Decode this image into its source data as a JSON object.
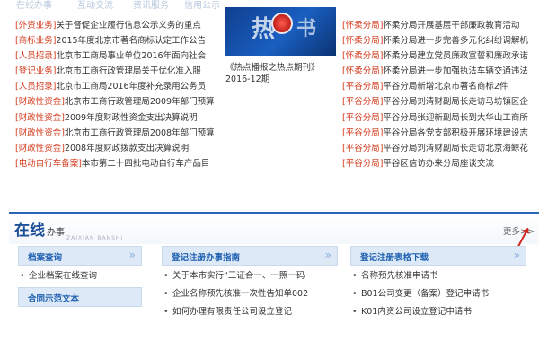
{
  "topnav": [
    "在线办事",
    "互动交流",
    "资讯服务",
    "信用公示"
  ],
  "left_news": [
    {
      "tag": "[外资业务]",
      "text": "关于督促企业履行信息公示义务的重点"
    },
    {
      "tag": "[商标业务]",
      "text": "2015年度北京市著名商标认定工作公告"
    },
    {
      "tag": "[人员招录]",
      "text": "北京市工商局事业单位2016年面向社会"
    },
    {
      "tag": "[登记业务]",
      "text": "北京市工商行政管理局关于优化准入服"
    },
    {
      "tag": "[人员招录]",
      "text": "北京市工商局2016年度补充录用公务员"
    },
    {
      "tag": "[财政性资金]",
      "text": "北京市工商行政管理局2009年部门预算",
      "wrap": true
    },
    {
      "tag": "[财政性资金]",
      "text": "2009年度财政性资金支出决算说明"
    },
    {
      "tag": "[财政性资金]",
      "text": "北京市工商行政管理局2008年部门预算",
      "wrap": true
    },
    {
      "tag": "[财政性资金]",
      "text": "2008年度财政拨款支出决算说明"
    },
    {
      "tag": "[电动自行车备案]",
      "text": "本市第二十四批电动自行车产品目"
    }
  ],
  "right_news": [
    {
      "tag": "[怀柔分局]",
      "text": "怀柔分局开展基层干部廉政教育活动"
    },
    {
      "tag": "[怀柔分局]",
      "text": "怀柔分局进一步完善多元化纠纷调解机"
    },
    {
      "tag": "[怀柔分局]",
      "text": "怀柔分局建立党员廉政宣誓和廉政承诺"
    },
    {
      "tag": "[怀柔分局]",
      "text": "怀柔分局进一步加强执法车辆交通违法"
    },
    {
      "tag": "[平谷分局]",
      "text": "平谷分局新增北京市著名商标2件"
    },
    {
      "tag": "[平谷分局]",
      "text": "平谷分局刘清财副局长走访马坊镇区企"
    },
    {
      "tag": "[平谷分局]",
      "text": "平谷分局张迎新副局长到大华山工商所"
    },
    {
      "tag": "[平谷分局]",
      "text": "平谷分局各党支部积极开展环境建设志"
    },
    {
      "tag": "[平谷分局]",
      "text": "平谷分局刘清财副局长走访北京海鲸花"
    },
    {
      "tag": "[平谷分局]",
      "text": "平谷区信访办来分局座谈交流"
    }
  ],
  "thumb": {
    "glyph1": "热",
    "glyph2": "书",
    "caption_line1": "《热点播报之热点期刊》",
    "caption_line2": "2016-12期"
  },
  "online": {
    "title": "在线",
    "title_suffix": "办事",
    "subtitle": "ZAIXIAN BANSHI",
    "more": "更多>>"
  },
  "boxes": {
    "archive": {
      "title": "档案查询",
      "items": [
        "企业档案在线查询"
      ],
      "title2": "合同示范文本"
    },
    "guide": {
      "title": "登记注册办事指南",
      "items": [
        "关于本市实行“三证合一、一照一码",
        "企业名称预先核准一次性告知单002",
        "如何办理有限责任公司设立登记"
      ]
    },
    "forms": {
      "title": "登记注册表格下载",
      "items": [
        "名称预先核准申请书",
        "B01公司变更（备案）登记申请书",
        "K01内资公司设立登记申请书"
      ]
    }
  },
  "colors": {
    "tag_red": "#d33a1c",
    "brand_blue": "#1d4f98",
    "box_head_bg": "#dde9f6"
  },
  "icons": [
    "double-chevron-right-icon",
    "red-arrow-icon"
  ]
}
